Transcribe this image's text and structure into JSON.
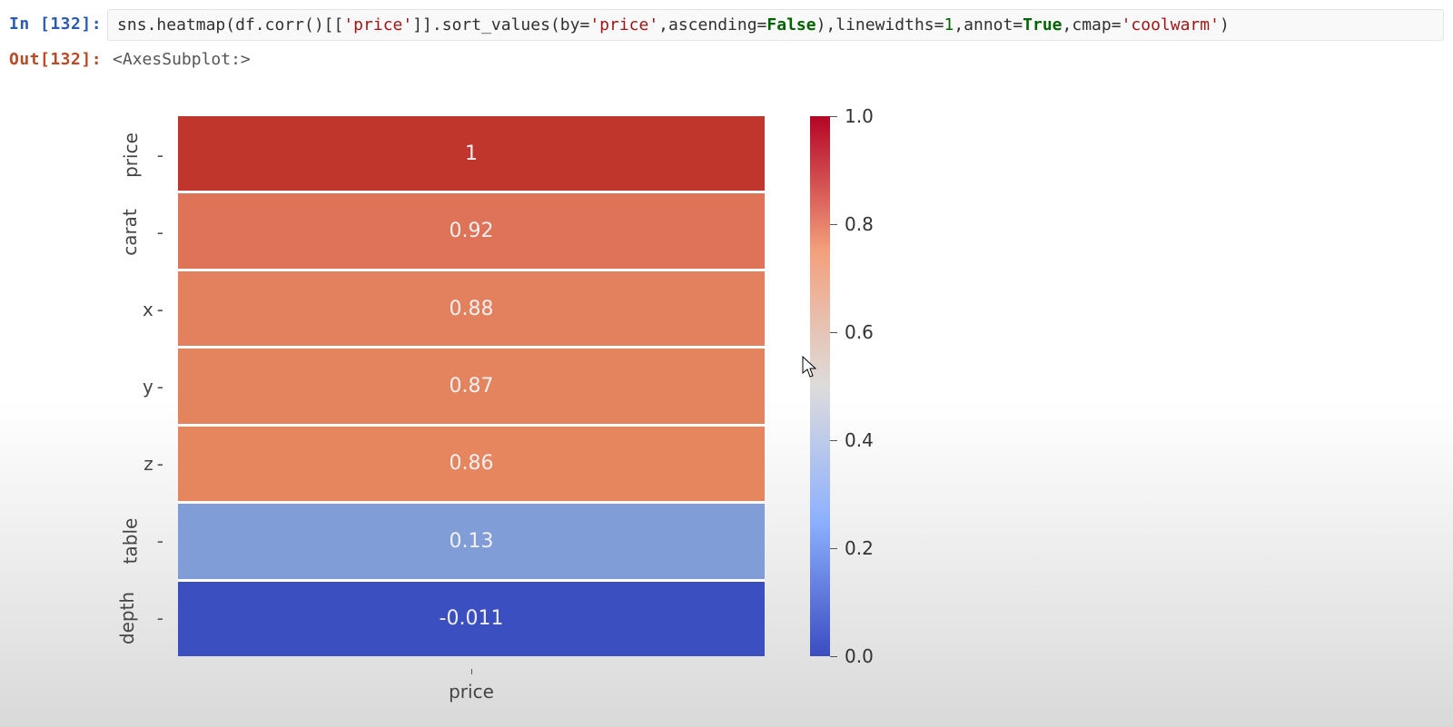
{
  "input_prompt": "In [132]:",
  "output_prompt": "Out[132]:",
  "code_tokens": [
    {
      "cls": "tk-plain",
      "t": "sns"
    },
    {
      "cls": "tk-plain",
      "t": "."
    },
    {
      "cls": "tk-call",
      "t": "heatmap"
    },
    {
      "cls": "tk-plain",
      "t": "(df"
    },
    {
      "cls": "tk-plain",
      "t": "."
    },
    {
      "cls": "tk-call",
      "t": "corr"
    },
    {
      "cls": "tk-plain",
      "t": "()[["
    },
    {
      "cls": "tk-str",
      "t": "'price'"
    },
    {
      "cls": "tk-plain",
      "t": "]]"
    },
    {
      "cls": "tk-plain",
      "t": "."
    },
    {
      "cls": "tk-call",
      "t": "sort_values"
    },
    {
      "cls": "tk-plain",
      "t": "(by="
    },
    {
      "cls": "tk-str",
      "t": "'price'"
    },
    {
      "cls": "tk-plain",
      "t": ",ascending="
    },
    {
      "cls": "tk-kw",
      "t": "False"
    },
    {
      "cls": "tk-plain",
      "t": "),linewidths="
    },
    {
      "cls": "tk-num",
      "t": "1"
    },
    {
      "cls": "tk-plain",
      "t": ",annot="
    },
    {
      "cls": "tk-kw",
      "t": "True"
    },
    {
      "cls": "tk-plain",
      "t": ",cmap="
    },
    {
      "cls": "tk-str",
      "t": "'coolwarm'"
    },
    {
      "cls": "tk-plain",
      "t": ")"
    }
  ],
  "output_text": "<AxesSubplot:>",
  "chart_data": {
    "type": "heatmap",
    "title": "",
    "xlabel": "price",
    "ylabel": "",
    "x_categories": [
      "price"
    ],
    "y_categories": [
      "price",
      "carat",
      "x",
      "y",
      "z",
      "table",
      "depth"
    ],
    "values": [
      [
        1
      ],
      [
        0.92
      ],
      [
        0.88
      ],
      [
        0.87
      ],
      [
        0.86
      ],
      [
        0.13
      ],
      [
        -0.011
      ]
    ],
    "annotations": [
      "1",
      "0.92",
      "0.88",
      "0.87",
      "0.86",
      "0.13",
      "-0.011"
    ],
    "cmap": "coolwarm",
    "colorbar_ticks": [
      0.0,
      0.2,
      0.4,
      0.6,
      0.8,
      1.0
    ],
    "vmin": -0.011,
    "vmax": 1.0,
    "linewidths": 1
  },
  "cell_colors": {
    "price": "#c0352c",
    "carat": "#de7358",
    "x": "#e3815f",
    "y": "#e4845f",
    "z": "#e5865f",
    "table": "#809dd8",
    "depth": "#3c4fc1"
  },
  "colorbar_gradient": [
    {
      "stop": 0,
      "color": "#3b4cc0"
    },
    {
      "stop": 25,
      "color": "#8db0fe"
    },
    {
      "stop": 50,
      "color": "#dddcdb"
    },
    {
      "stop": 75,
      "color": "#f3a07d"
    },
    {
      "stop": 100,
      "color": "#b40426"
    }
  ]
}
